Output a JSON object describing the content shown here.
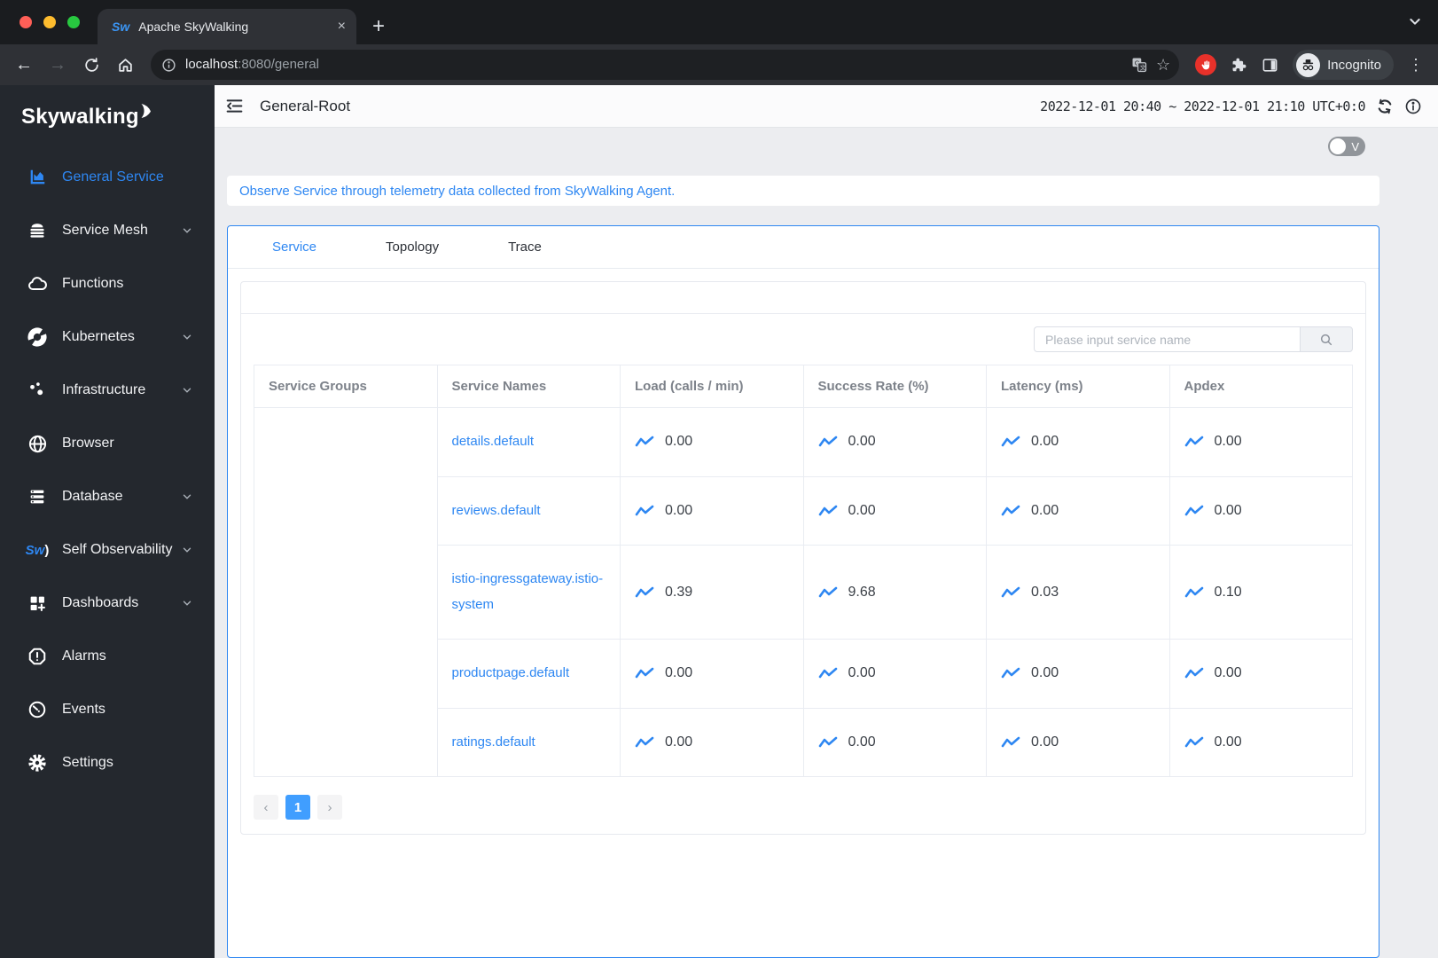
{
  "browser": {
    "tab": {
      "favicon": "Sw",
      "title": "Apache SkyWalking",
      "close": "×"
    },
    "new_tab": "+",
    "url": {
      "host": "localhost",
      "rest": ":8080/general"
    },
    "incognito_label": "Incognito",
    "menu_dots": "⋮",
    "bookmark_star": "☆",
    "back_arrow": "←",
    "forward_arrow": "→"
  },
  "app_header": {
    "title": "General-Root",
    "time_range": "2022-12-01 20:40 ~ 2022-12-01 21:10 UTC+0:0"
  },
  "version_toggle": {
    "label": "V"
  },
  "sidebar": {
    "logo_text": "Skywalking",
    "items": [
      {
        "label": "General Service"
      },
      {
        "label": "Service Mesh"
      },
      {
        "label": "Functions"
      },
      {
        "label": "Kubernetes"
      },
      {
        "label": "Infrastructure"
      },
      {
        "label": "Browser"
      },
      {
        "label": "Database"
      },
      {
        "label": "Self Observability"
      },
      {
        "label": "Dashboards"
      },
      {
        "label": "Alarms"
      },
      {
        "label": "Events"
      },
      {
        "label": "Settings"
      }
    ]
  },
  "banner": {
    "text": "Observe Service through telemetry data collected from SkyWalking Agent."
  },
  "tabs": {
    "items": [
      {
        "label": "Service"
      },
      {
        "label": "Topology"
      },
      {
        "label": "Trace"
      }
    ]
  },
  "search": {
    "placeholder": "Please input service name"
  },
  "table": {
    "columns": [
      "Service Groups",
      "Service Names",
      "Load (calls / min)",
      "Success Rate (%)",
      "Latency (ms)",
      "Apdex"
    ],
    "rows": [
      {
        "group": "",
        "name": "details.default",
        "load": "0.00",
        "success_rate": "0.00",
        "latency": "0.00",
        "apdex": "0.00"
      },
      {
        "name": "reviews.default",
        "load": "0.00",
        "success_rate": "0.00",
        "latency": "0.00",
        "apdex": "0.00"
      },
      {
        "name": "istio-ingressgateway.istio-system",
        "load": "0.39",
        "success_rate": "9.68",
        "latency": "0.03",
        "apdex": "0.10"
      },
      {
        "name": "productpage.default",
        "load": "0.00",
        "success_rate": "0.00",
        "latency": "0.00",
        "apdex": "0.00"
      },
      {
        "name": "ratings.default",
        "load": "0.00",
        "success_rate": "0.00",
        "latency": "0.00",
        "apdex": "0.00"
      }
    ]
  },
  "pagination": {
    "prev": "‹",
    "current": "1",
    "next": "›"
  },
  "colors": {
    "accent_blue": "#2e87f2",
    "pagination_active": "#409eff",
    "sidebar_bg": "#24282e",
    "chrome_dark": "#1a1c1f",
    "chrome_toolbar": "#2f3136",
    "content_bg": "#ecedf0",
    "traffic_red": "#ff5f57",
    "traffic_yellow": "#febc2e",
    "traffic_green": "#28c840"
  }
}
